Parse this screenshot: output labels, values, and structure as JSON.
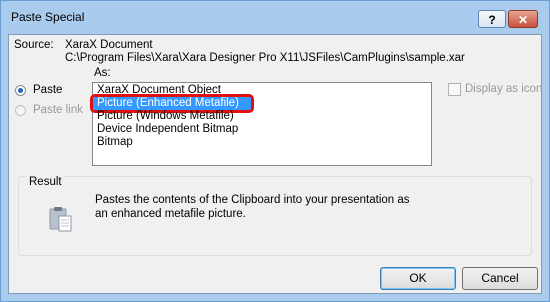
{
  "window": {
    "title": "Paste Special",
    "help_label": "?",
    "close_label": "✕"
  },
  "source": {
    "label": "Source:",
    "name": "XaraX Document",
    "path": "C:\\Program Files\\Xara\\Xara Designer Pro X11\\JSFiles\\CamPlugins\\sample.xar"
  },
  "as_label": "As:",
  "options": {
    "paste": {
      "label": "Paste",
      "selected": true
    },
    "paste_link": {
      "label": "Paste link",
      "selected": false,
      "enabled": false
    }
  },
  "formats": [
    "XaraX Document Object",
    "Picture (Enhanced Metafile)",
    "Picture (Windows Metafile)",
    "Device Independent Bitmap",
    "Bitmap"
  ],
  "selected_format_index": 1,
  "display_as_icon": {
    "label": "Display as icon",
    "checked": false
  },
  "result": {
    "title": "Result",
    "text_line1": "Pastes the contents of the Clipboard into your presentation as",
    "text_line2": "an enhanced metafile picture.",
    "icon": "clipboard-paste-icon"
  },
  "buttons": {
    "ok": "OK",
    "cancel": "Cancel"
  },
  "colors": {
    "title_bar": "#a9cbee",
    "selection": "#3399ff",
    "highlight_box": "#e01010"
  }
}
